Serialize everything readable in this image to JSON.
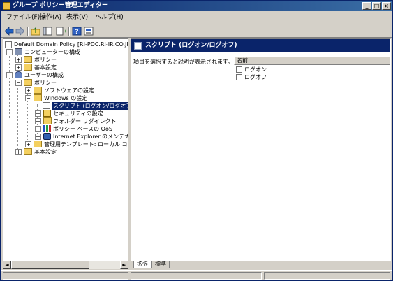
{
  "window": {
    "title": "グループ ポリシー管理エディター"
  },
  "menu": [
    {
      "id": "file",
      "label": "ファイル(F)"
    },
    {
      "id": "action",
      "label": "操作(A)"
    },
    {
      "id": "view",
      "label": "表示(V)"
    },
    {
      "id": "help",
      "label": "ヘルプ(H)"
    }
  ],
  "toolbar": [
    "back-arrow-icon",
    "forward-arrow-icon",
    "up-folder-icon",
    "show-hide-tree-icon",
    "export-list-icon",
    "help-icon",
    "properties-icon"
  ],
  "tree": [
    {
      "label": "Default Domain Policy [RI-PDC.RI-IR.CO.JP",
      "expander": "",
      "icon": "doc"
    },
    {
      "label": "コンピューターの構成",
      "expander": "−",
      "icon": "computer"
    },
    {
      "label": "ポリシー",
      "expander": "+",
      "icon": "folder"
    },
    {
      "label": "基本設定",
      "expander": "+",
      "icon": "folder"
    },
    {
      "label": "ユーザーの構成",
      "expander": "−",
      "icon": "user"
    },
    {
      "label": "ポリシー",
      "expander": "−",
      "icon": "folder"
    },
    {
      "label": "ソフトウェアの設定",
      "expander": "+",
      "icon": "folder"
    },
    {
      "label": "Windows の設定",
      "expander": "−",
      "icon": "folder"
    },
    {
      "label": "スクリプト (ログオン/ログオフ)",
      "expander": "",
      "icon": "script",
      "selected": true
    },
    {
      "label": "セキュリティの設定",
      "expander": "+",
      "icon": "security"
    },
    {
      "label": "フォルダー リダイレクト",
      "expander": "+",
      "icon": "folder"
    },
    {
      "label": "ポリシー ベースの QoS",
      "expander": "+",
      "icon": "chart"
    },
    {
      "label": "Internet Explorer のメンテナンス",
      "expander": "+",
      "icon": "ie"
    },
    {
      "label": "管理用テンプレート: ローカル コンピュ",
      "expander": "+",
      "icon": "folder"
    },
    {
      "label": "基本設定",
      "expander": "+",
      "icon": "folder"
    }
  ],
  "right": {
    "header": "スクリプト (ログオン/ログオフ)",
    "description": "項目を選択すると説明が表示されます。",
    "column": "名前",
    "items": [
      "ログオン",
      "ログオフ"
    ]
  },
  "tabs": [
    {
      "label": "拡張",
      "active": true
    },
    {
      "label": "標準",
      "active": false
    }
  ]
}
